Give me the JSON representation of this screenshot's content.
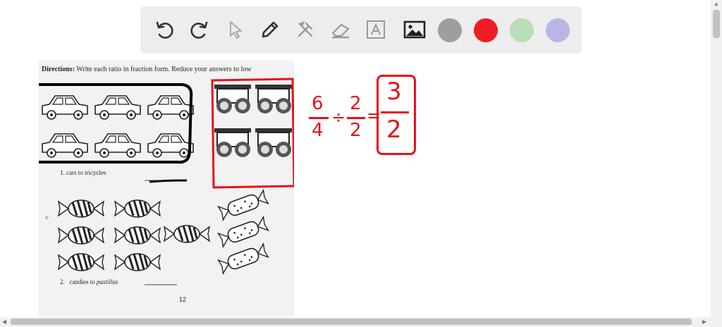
{
  "toolbar": {
    "tools": [
      "undo-icon",
      "redo-icon",
      "pointer-icon",
      "pen-icon",
      "tools-icon",
      "eraser-icon",
      "text-icon",
      "image-icon"
    ],
    "colors": [
      "#9e9e9e",
      "#ee1c25",
      "#b9dcb9",
      "#b8b6e8"
    ]
  },
  "worksheet": {
    "directions_label": "Directions:",
    "directions_text": "Write each ratio in fraction form. Reduce your answers to low",
    "item1": "1. cars to tricycles",
    "item2_num": "2.",
    "item2_text": "candies to ",
    "item2_italic": "pastillas",
    "side_letter": "c",
    "page_number": "12"
  },
  "handwriting": {
    "frac1_num": "6",
    "frac1_den": "4",
    "op": "÷",
    "frac2_num": "2",
    "frac2_den": "2",
    "eq": "=",
    "answer_num": "3",
    "answer_den": "2",
    "ink_color": "#e8101c"
  }
}
